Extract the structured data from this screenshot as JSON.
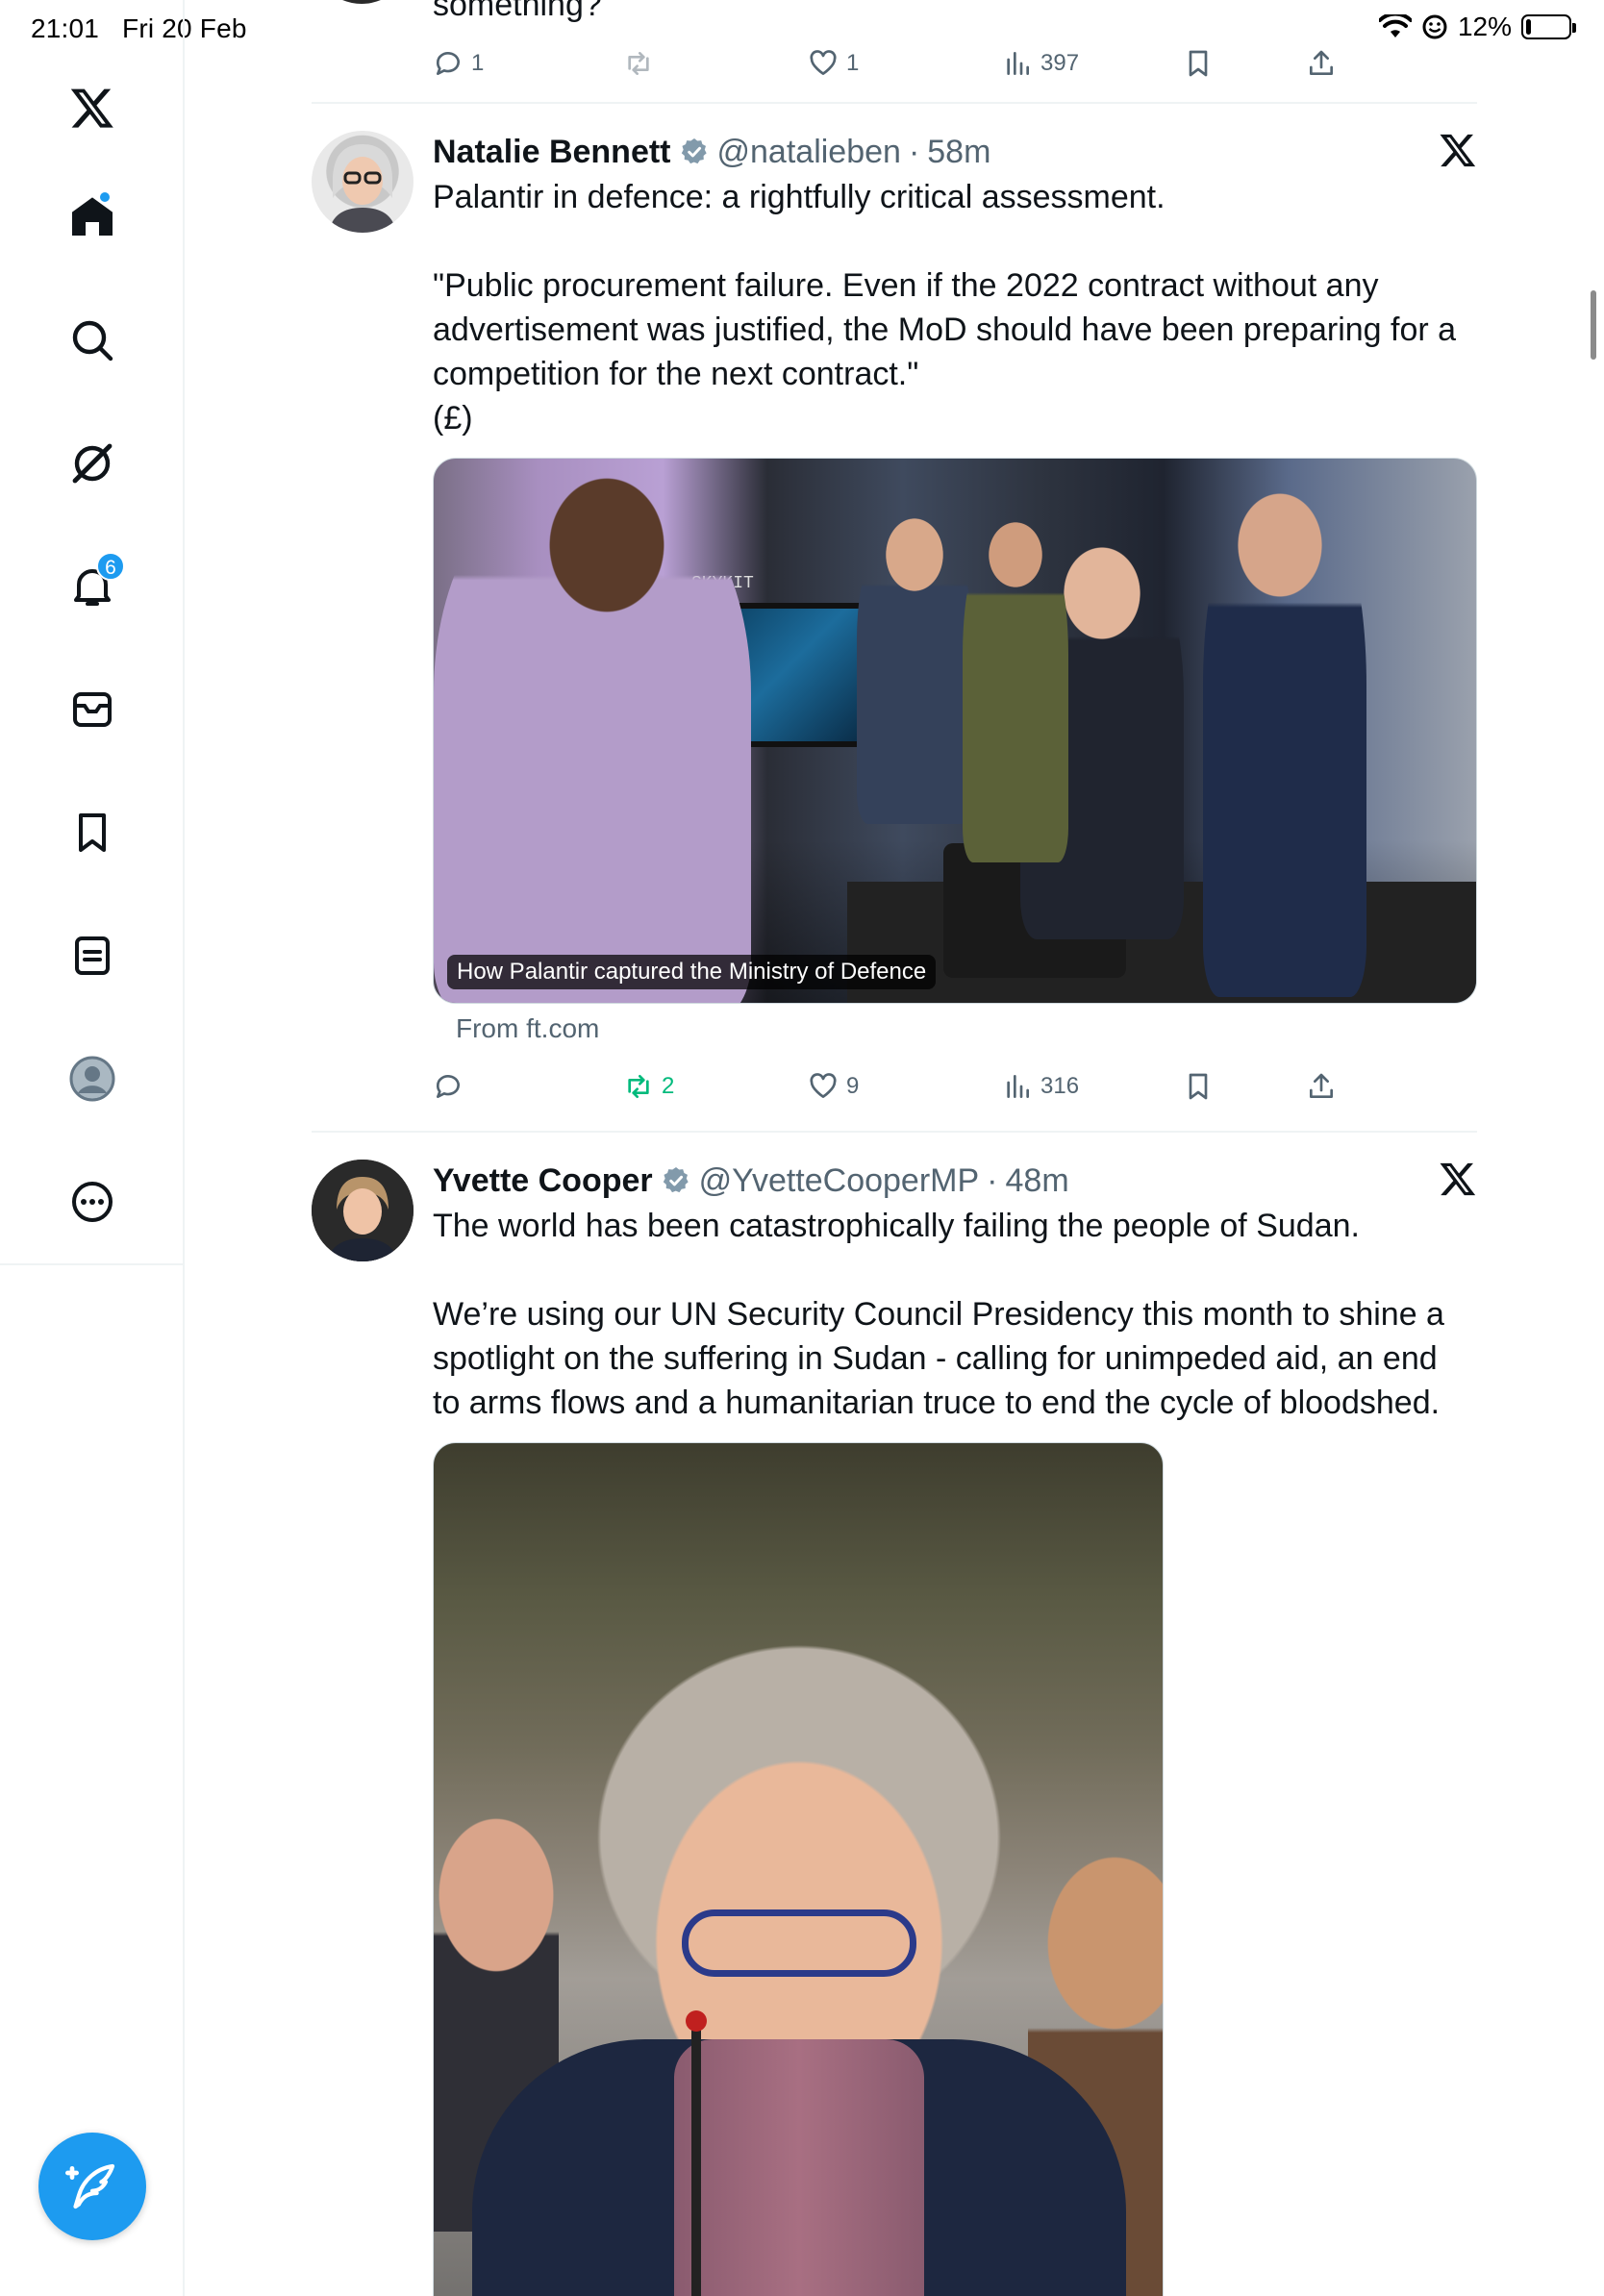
{
  "status_bar": {
    "time": "21:01",
    "date": "Fri 20 Feb",
    "battery": "12%",
    "battery_level": 0.12
  },
  "sidebar": {
    "items": [
      {
        "name": "x-logo",
        "icon": "x-logo-icon"
      },
      {
        "name": "home",
        "icon": "home-icon",
        "has_dot": true
      },
      {
        "name": "explore",
        "icon": "search-icon"
      },
      {
        "name": "grok",
        "icon": "grok-icon"
      },
      {
        "name": "notifications",
        "icon": "bell-icon",
        "badge": "6"
      },
      {
        "name": "messages",
        "icon": "mail-icon"
      },
      {
        "name": "bookmarks",
        "icon": "bookmark-icon"
      },
      {
        "name": "lists",
        "icon": "list-icon"
      },
      {
        "name": "profile",
        "icon": "avatar-icon"
      },
      {
        "name": "more",
        "icon": "more-icon"
      }
    ],
    "compose_icon": "compose-icon"
  },
  "feed": {
    "previous_tweet": {
      "text_fragment": "something?",
      "actions": {
        "replies": "1",
        "retweets": "",
        "likes": "1",
        "views": "397"
      }
    },
    "tweets": [
      {
        "display_name": "Natalie Bennett",
        "handle": "@natalieben",
        "separator": "·",
        "time": "58m",
        "text": "Palantir in defence: a rightfully critical assessment.\n\n\"Public procurement failure. Even if the 2022 contract without any advertisement was justified, the MoD should have been preparing for a competition for the next contract.\"\n(£)",
        "media_caption": "How Palantir captured the Ministry of Defence",
        "link_source": "From ft.com",
        "media_label": "SKYKIT",
        "actions": {
          "replies": "",
          "retweets": "2",
          "likes": "9",
          "views": "316"
        },
        "retweeted": true
      },
      {
        "display_name": "Yvette Cooper",
        "handle": "@YvetteCooperMP",
        "separator": "·",
        "time": "48m",
        "text": "The world has been catastrophically failing the people of Sudan.\n\nWe’re using our UN Security Council Presidency this month to shine a spotlight on the suffering in Sudan - calling for unimpeded aid, an end to arms flows and a humanitarian truce to end the cycle of bloodshed."
      }
    ]
  },
  "colors": {
    "accent": "#1d9bf0",
    "retweet_green": "#00ba7c",
    "secondary_text": "#536471",
    "divider": "#eff3f4"
  }
}
